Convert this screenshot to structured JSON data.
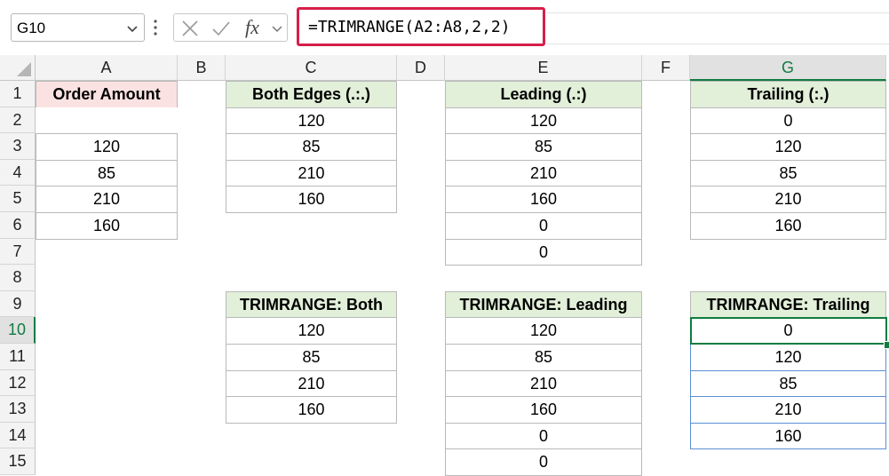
{
  "name_box": {
    "value": "G10"
  },
  "formula_bar": {
    "formula": "=TRIMRANGE(A2:A8,2,2)",
    "fx_label": "fx"
  },
  "columns": [
    "A",
    "B",
    "C",
    "D",
    "E",
    "F",
    "G"
  ],
  "rows": [
    "1",
    "2",
    "3",
    "4",
    "5",
    "6",
    "7",
    "8",
    "9",
    "10",
    "11",
    "12",
    "13",
    "14",
    "15"
  ],
  "selected": {
    "column": "G",
    "row": "10"
  },
  "tables": {
    "order_amount": {
      "header": "Order Amount",
      "values": [
        "",
        "120",
        "85",
        "210",
        "160"
      ]
    },
    "both_edges": {
      "header": "Both Edges (.:.)",
      "values": [
        "120",
        "85",
        "210",
        "160"
      ]
    },
    "leading": {
      "header": "Leading (.:)",
      "values": [
        "120",
        "85",
        "210",
        "160",
        "0",
        "0"
      ]
    },
    "trailing": {
      "header": "Trailing (:.)",
      "values": [
        "0",
        "120",
        "85",
        "210",
        "160"
      ]
    },
    "trimrange_both": {
      "header": "TRIMRANGE: Both",
      "values": [
        "120",
        "85",
        "210",
        "160"
      ]
    },
    "trimrange_leading": {
      "header": "TRIMRANGE: Leading",
      "values": [
        "120",
        "85",
        "210",
        "160",
        "0",
        "0"
      ]
    },
    "trimrange_trailing": {
      "header": "TRIMRANGE: Trailing",
      "values": [
        "0",
        "120",
        "85",
        "210",
        "160"
      ]
    }
  },
  "colors": {
    "accent": "#107c41",
    "formula_highlight": "#d61f4a",
    "header_green": "#e2efd9",
    "header_pink": "#fbe2e2"
  }
}
